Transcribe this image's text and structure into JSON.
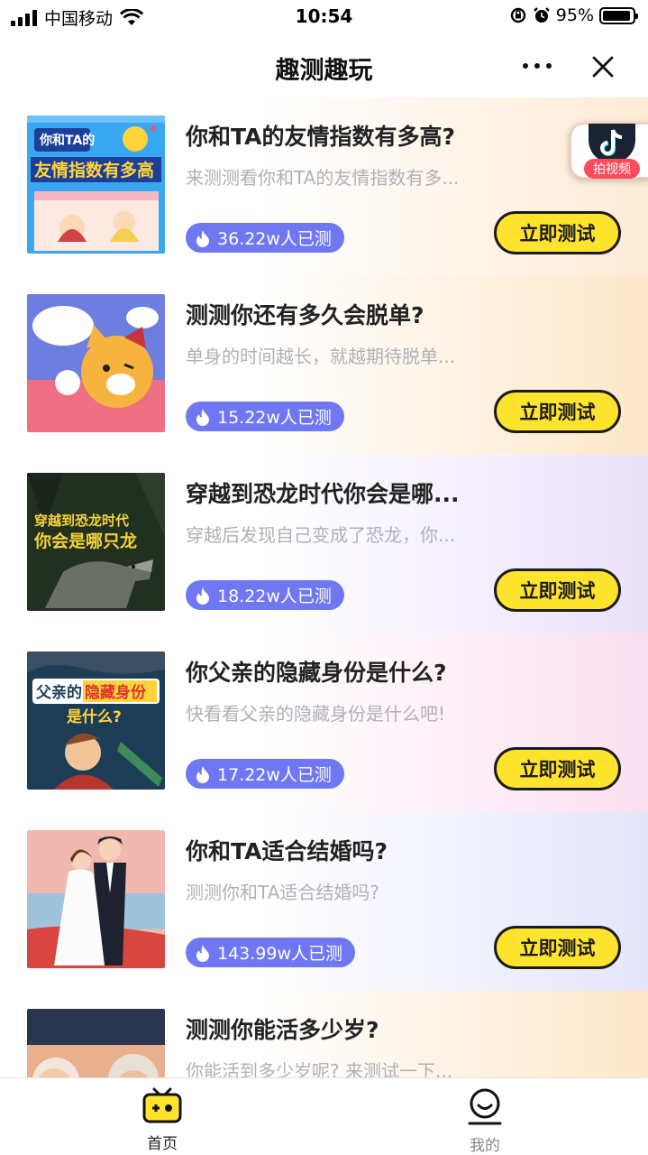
{
  "status_bar": {
    "carrier": "中国移动",
    "time": "10:54",
    "battery": "95%",
    "battery_level": 0.95
  },
  "nav": {
    "title": "趣测趣玩"
  },
  "float_button": {
    "label": "拍视频"
  },
  "cards": [
    {
      "title": "你和TA的友情指数有多高?",
      "desc": "来测测看你和TA的友情指数有多...",
      "count": "36.22w人已测",
      "button": "立即测试",
      "thumb_text": "你和TA的友情指数有多高",
      "bg_color": "#fdebd6"
    },
    {
      "title": "测测你还有多久会脱单?",
      "desc": "单身的时间越长，就越期待脱单...",
      "count": "15.22w人已测",
      "button": "立即测试",
      "thumb_text": "",
      "bg_color": "#fde7c9"
    },
    {
      "title": "穿越到恐龙时代你会是哪...",
      "desc": "穿越后发现自己变成了恐龙，你...",
      "count": "18.22w人已测",
      "button": "立即测试",
      "thumb_text": "穿越到恐龙时代你会是哪只龙",
      "bg_color": "#ebe2fb"
    },
    {
      "title": "你父亲的隐藏身份是什么?",
      "desc": "快看看父亲的隐藏身份是什么吧!",
      "count": "17.22w人已测",
      "button": "立即测试",
      "thumb_text": "父亲的隐藏身份是什么?",
      "bg_color": "#fbe0ef"
    },
    {
      "title": "你和TA适合结婚吗?",
      "desc": "测测你和TA适合结婚吗?",
      "count": "143.99w人已测",
      "button": "立即测试",
      "thumb_text": "",
      "bg_color": "#e4e6fb"
    },
    {
      "title": "测测你能活多少岁?",
      "desc": "你能活到多少岁呢? 来测试一下...",
      "count": "",
      "button": "",
      "thumb_text": "",
      "bg_color": "#fde7c9"
    }
  ],
  "tabbar": {
    "items": [
      {
        "label": "首页",
        "active": true
      },
      {
        "label": "我的",
        "active": false
      }
    ]
  }
}
